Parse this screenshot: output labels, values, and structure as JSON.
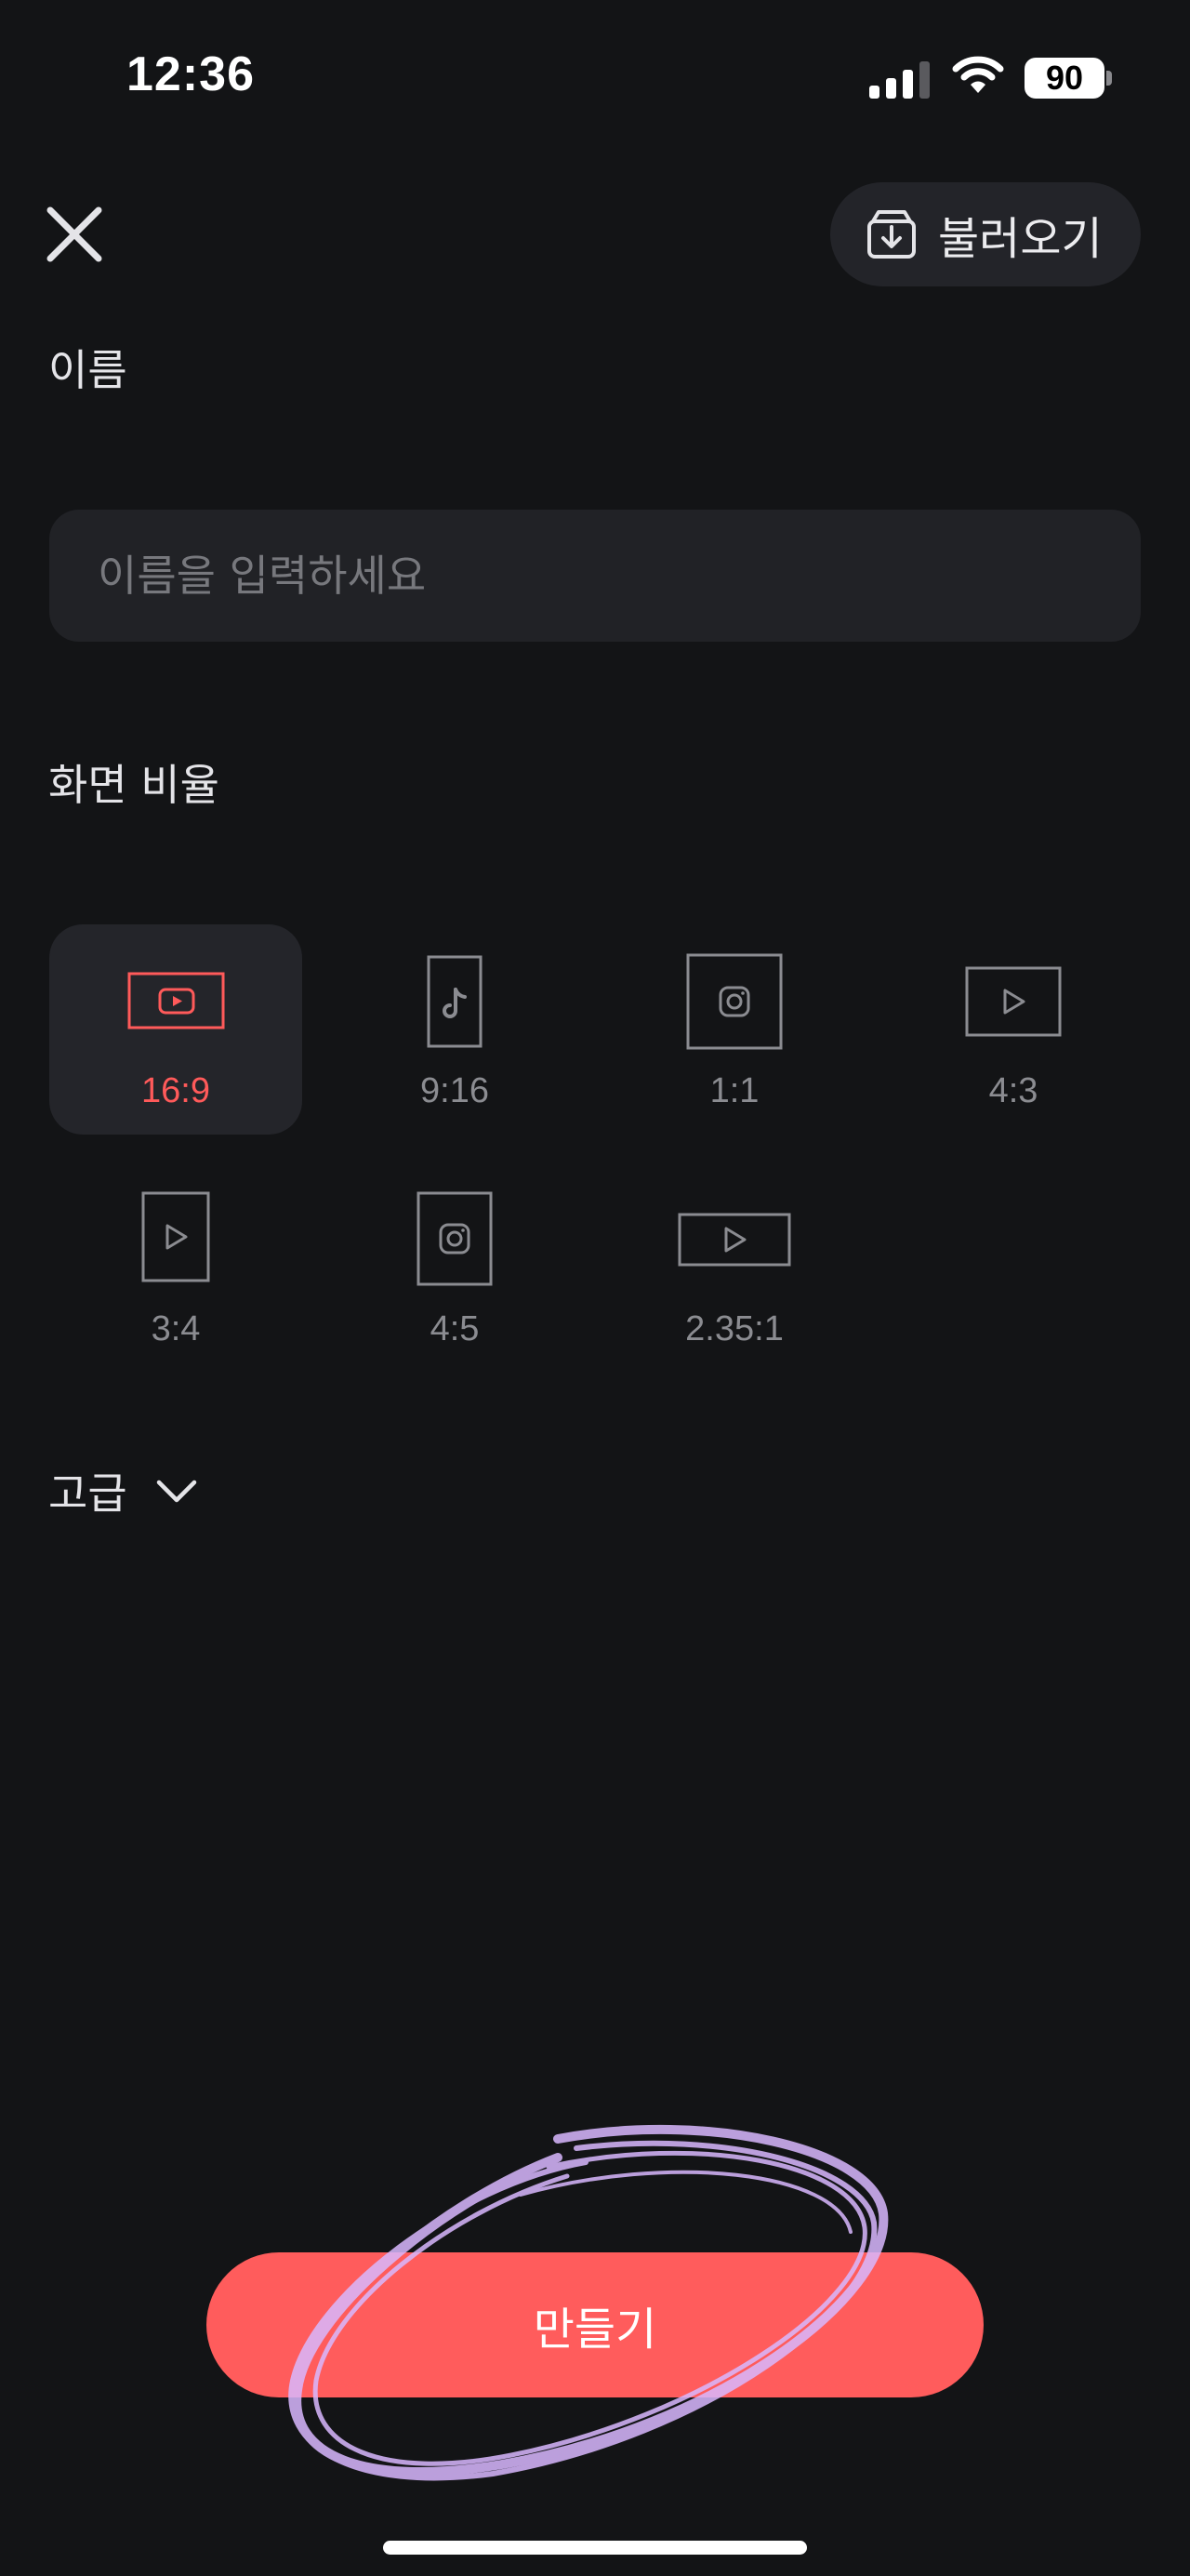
{
  "status_bar": {
    "time": "12:36",
    "battery": "90",
    "icons": [
      "signal-icon",
      "wifi-icon",
      "battery-icon"
    ]
  },
  "header": {
    "close_icon": "close-icon",
    "import_label": "불러오기",
    "import_icon": "import-box-icon"
  },
  "form": {
    "name_label": "이름",
    "name_placeholder": "이름을 입력하세요",
    "name_value": "",
    "ratio_label": "화면 비율"
  },
  "ratios": [
    {
      "label": "16:9",
      "icon": "youtube-icon",
      "selected": true
    },
    {
      "label": "9:16",
      "icon": "tiktok-icon",
      "selected": false
    },
    {
      "label": "1:1",
      "icon": "instagram-icon",
      "selected": false
    },
    {
      "label": "4:3",
      "icon": "play-icon",
      "selected": false
    },
    {
      "label": "3:4",
      "icon": "play-icon",
      "selected": false
    },
    {
      "label": "4:5",
      "icon": "instagram-icon",
      "selected": false
    },
    {
      "label": "2.35:1",
      "icon": "play-icon",
      "selected": false
    }
  ],
  "advanced": {
    "label": "고급",
    "icon": "chevron-down-icon"
  },
  "create_button": {
    "label": "만들기"
  },
  "colors": {
    "background": "#131416",
    "surface": "#212226",
    "accent": "#ff5c5c",
    "muted_text": "#8b8c91",
    "annotation": "#d9b8ff"
  }
}
